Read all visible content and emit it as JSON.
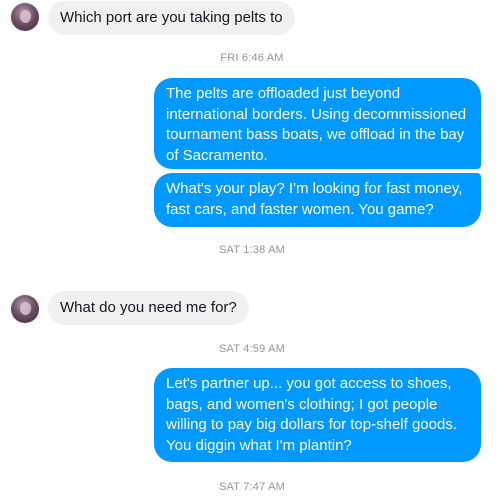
{
  "conversation": {
    "messages": [
      {
        "sender": "contact",
        "text": "Which port are you taking pelts to"
      },
      {
        "timestamp": "FRI 6:46 AM"
      },
      {
        "sender": "me",
        "text": "The pelts are offloaded just beyond international borders. Using decommissioned tournament bass boats, we offload in the bay of Sacramento."
      },
      {
        "sender": "me",
        "text": "What's your play? I'm looking for fast money, fast cars, and faster women. You game?"
      },
      {
        "timestamp": "SAT 1:38 AM"
      },
      {
        "sender": "contact",
        "text": "What do you need me for?"
      },
      {
        "timestamp": "SAT 4:59 AM"
      },
      {
        "sender": "me",
        "text": "Let's partner up... you got access to shoes, bags, and women's clothing; I got people willing to pay big dollars for top-shelf goods. You diggin what I'm plantin?"
      },
      {
        "timestamp": "SAT 7:47 AM"
      }
    ]
  },
  "colors": {
    "outgoing_bubble": "#0099ff",
    "incoming_bubble": "#f1f0f0",
    "timestamp_text": "#90949c"
  }
}
